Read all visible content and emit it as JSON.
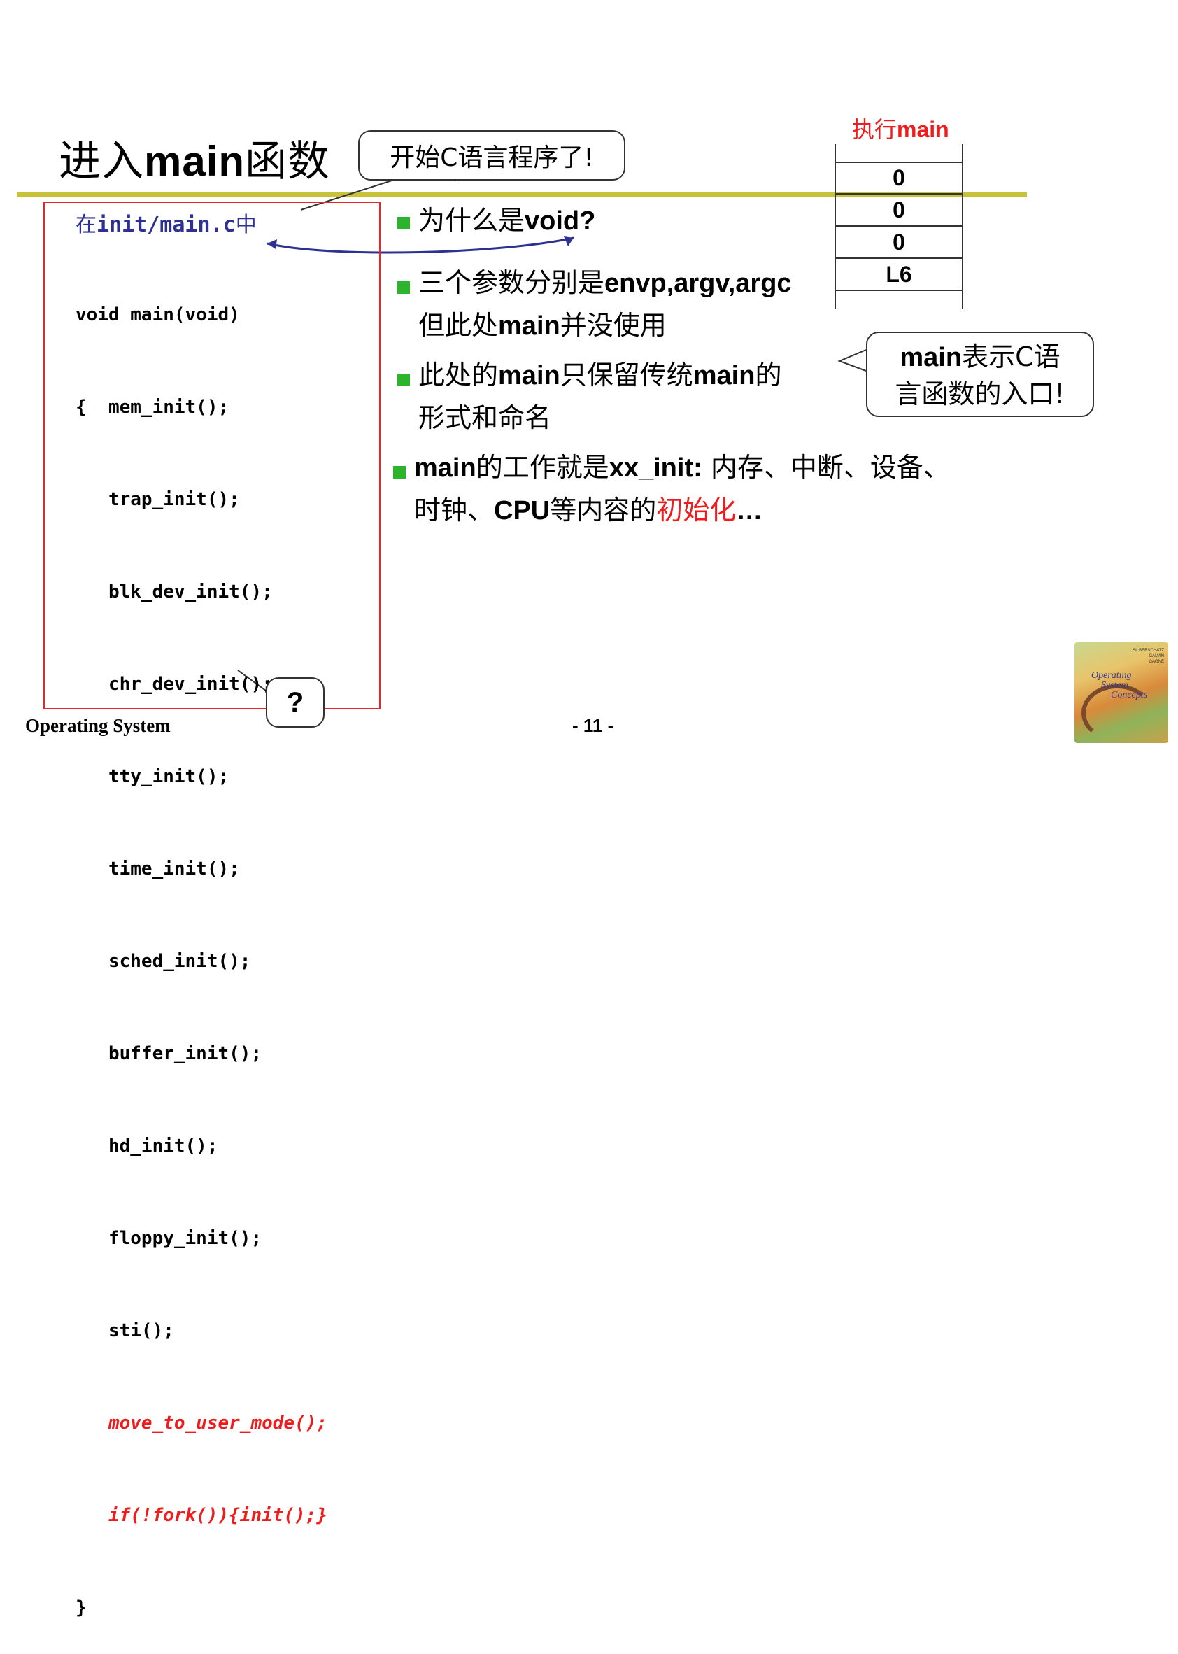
{
  "title": {
    "cn1": "进入",
    "en": "main",
    "cn2": "函数"
  },
  "callout_top": "开始C语言程序了!",
  "code": {
    "path_cn1": "在",
    "path_mono": "init/main.c",
    "path_cn2": "中",
    "lines": [
      "void main(void)",
      "{  mem_init();",
      "   trap_init();",
      "   blk_dev_init();",
      "   chr_dev_init();",
      "   tty_init();",
      "   time_init();",
      "   sched_init();",
      "   buffer_init();",
      "   hd_init();",
      "   floppy_init();",
      "   sti();"
    ],
    "red_lines": [
      "   move_to_user_mode();",
      "   if(!fork()){init();}"
    ],
    "close": "}"
  },
  "bullets": {
    "b1": {
      "cn": "为什么是",
      "en": "void?"
    },
    "b2": {
      "cn1": "三个参数分别是",
      "en": "envp,argv,argc",
      "line2_cn1": "但此处",
      "line2_en": "main",
      "line2_cn2": "并没使用"
    },
    "b3": {
      "cn1": "此处的",
      "en1": "main",
      "cn2": "只保留传统",
      "en2": "main",
      "cn3": "的",
      "line2": "形式和命名"
    },
    "b4": {
      "en1": "main",
      "cn1": "的工作就是",
      "en2": "xx_init:",
      "cn2": " 内存、中断、设备、",
      "line2_cn1": "时钟、",
      "line2_en": "CPU",
      "line2_cn2": "等内容的",
      "line2_red": "初始化",
      "line2_end": "…"
    }
  },
  "stack": {
    "label_cn": "执行",
    "label_en": "main",
    "cells": [
      "0",
      "0",
      "0",
      "L6"
    ]
  },
  "callout_right": {
    "line1_en": "main",
    "line1_cn": "表示C语",
    "line2": "言函数的入口!"
  },
  "callout_q": "?",
  "footer": {
    "left": "Operating System",
    "center": "- 11 -"
  },
  "book": {
    "title_lines": [
      "Operating",
      "System",
      "Concepts"
    ],
    "authors": [
      "SILBERSCHATZ",
      "GALVIN",
      "GAGNE"
    ]
  },
  "colors": {
    "accent_rule": "#c8c23a",
    "code_box": "#e8262a",
    "path_blue": "#2e3192",
    "highlight_red": "#ee1c1c",
    "bullet_green": "#2cb52c"
  }
}
